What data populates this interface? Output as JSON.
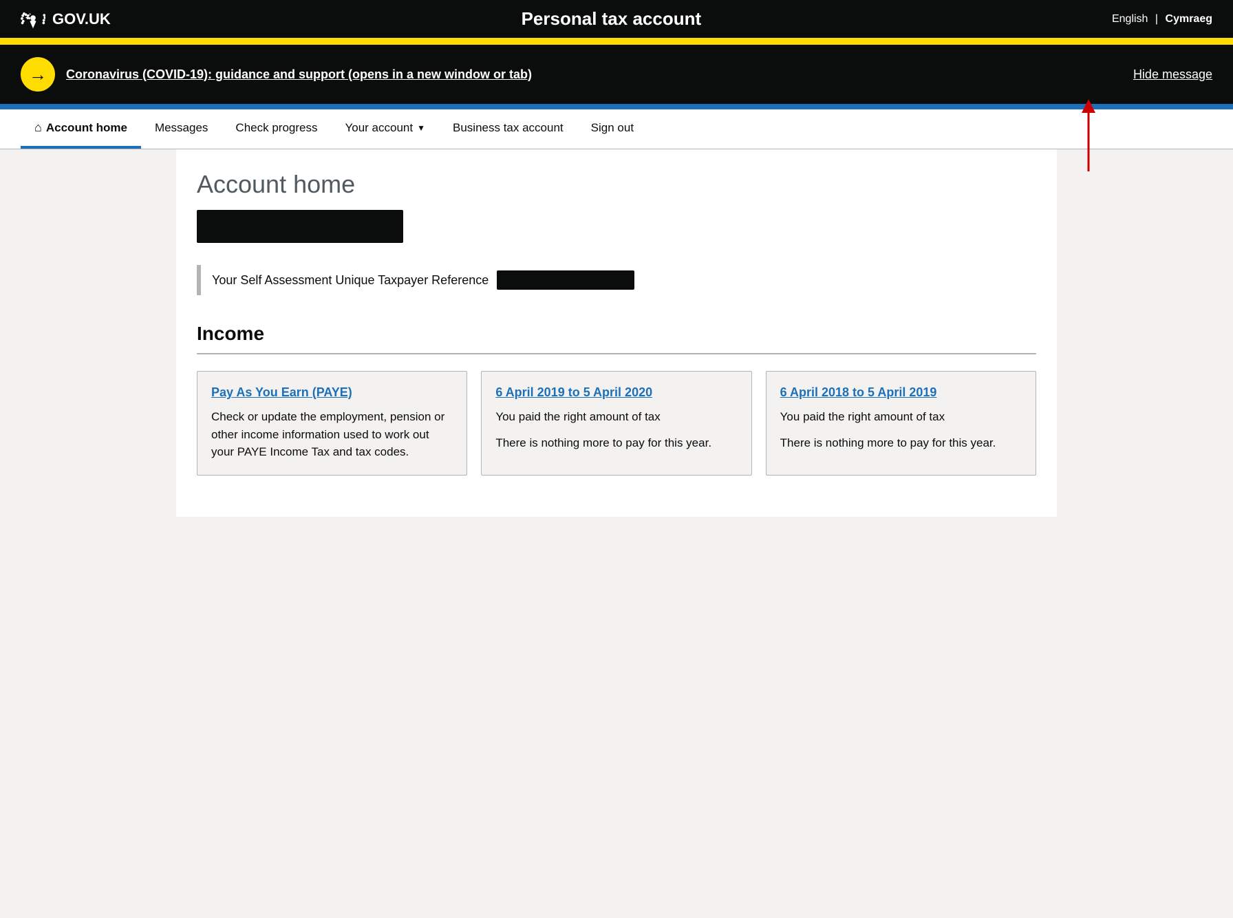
{
  "header": {
    "logo_text": "GOV.UK",
    "title": "Personal tax account",
    "lang_english": "English",
    "lang_separator": "|",
    "lang_welsh": "Cymraeg"
  },
  "covid_banner": {
    "link_text": "Coronavirus (COVID-19): guidance and support (opens in a new window or tab)",
    "hide_text": "Hide message",
    "icon_arrow": "→"
  },
  "nav": {
    "items": [
      {
        "label": "Account home",
        "active": true,
        "has_home_icon": true
      },
      {
        "label": "Messages",
        "active": false
      },
      {
        "label": "Check progress",
        "active": false
      },
      {
        "label": "Your account",
        "active": false,
        "has_dropdown": true
      },
      {
        "label": "Business tax account",
        "active": false
      },
      {
        "label": "Sign out",
        "active": false
      }
    ]
  },
  "main": {
    "page_title": "Account home",
    "utr_label": "Your Self Assessment Unique Taxpayer Reference",
    "income_section": {
      "title": "Income",
      "cards": [
        {
          "title": "Pay As You Earn (PAYE)",
          "text1": "Check or update the employment, pension or other income information used to work out your PAYE Income Tax and tax codes."
        },
        {
          "title": "6 April 2019 to 5 April 2020",
          "text1": "You paid the right amount of tax",
          "text2": "There is nothing more to pay for this year."
        },
        {
          "title": "6 April 2018 to 5 April 2019",
          "text1": "You paid the right amount of tax",
          "text2": "There is nothing more to pay for this year."
        }
      ]
    }
  }
}
